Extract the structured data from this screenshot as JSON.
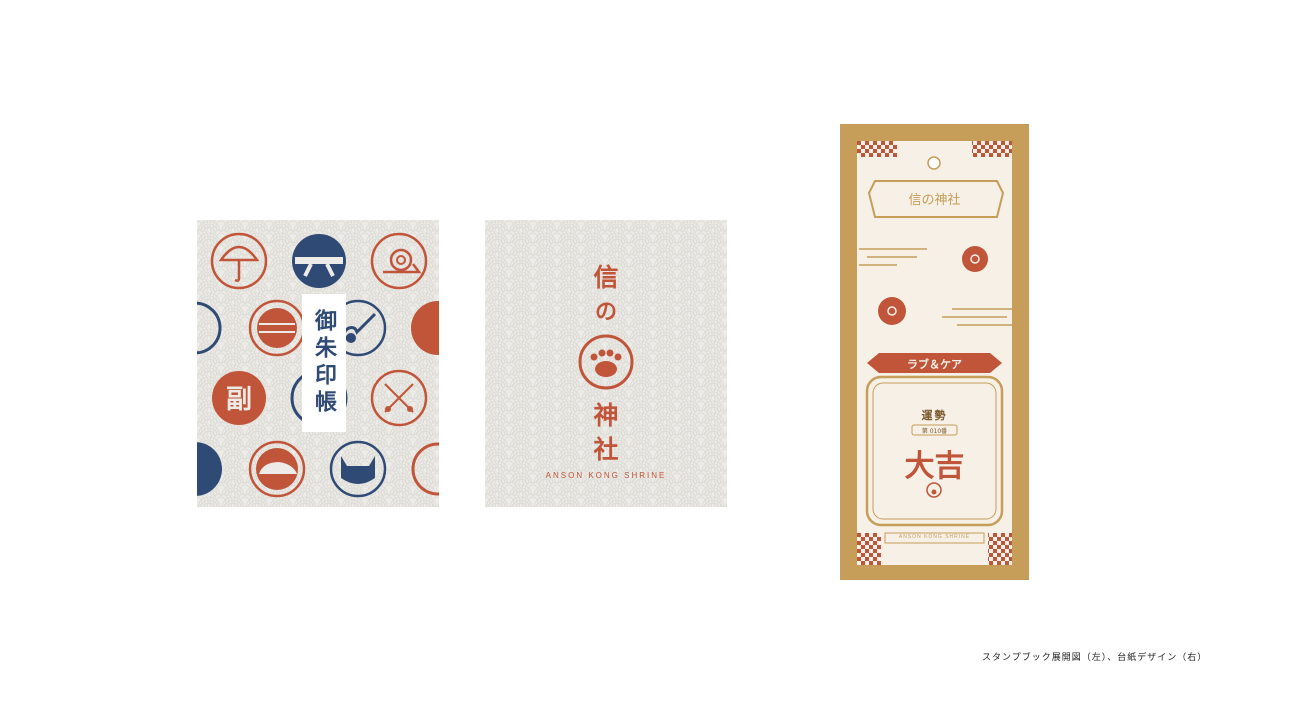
{
  "cover": {
    "title": "御朱印帳",
    "stamp_icons": [
      "umbrella-icon",
      "belt-icon",
      "snail-icon",
      "ball-icon",
      "guitar-icon",
      "calligraphy-icon",
      "swords-icon",
      "car-icon",
      "wolf-icon"
    ]
  },
  "inner": {
    "shrine_char_1": "信",
    "shrine_char_2": "の",
    "shrine_char_3": "神",
    "shrine_char_4": "社",
    "shrine_en": "ANSON KONG SHRINE"
  },
  "card": {
    "banner_title": "信の神社",
    "ribbon_text": "ラブ＆ケア",
    "fortune_label": "運勢",
    "number_label": "第 010番",
    "fortune_result": "大吉",
    "footer_en": "ANSON KONG SHRINE"
  },
  "caption": "スタンプブック展開図（左）、台紙デザイン（右）",
  "colors": {
    "navy": "#2f4a75",
    "vermilion": "#c1553a",
    "gold": "#c79d5a",
    "paper": "#ecebe7"
  }
}
